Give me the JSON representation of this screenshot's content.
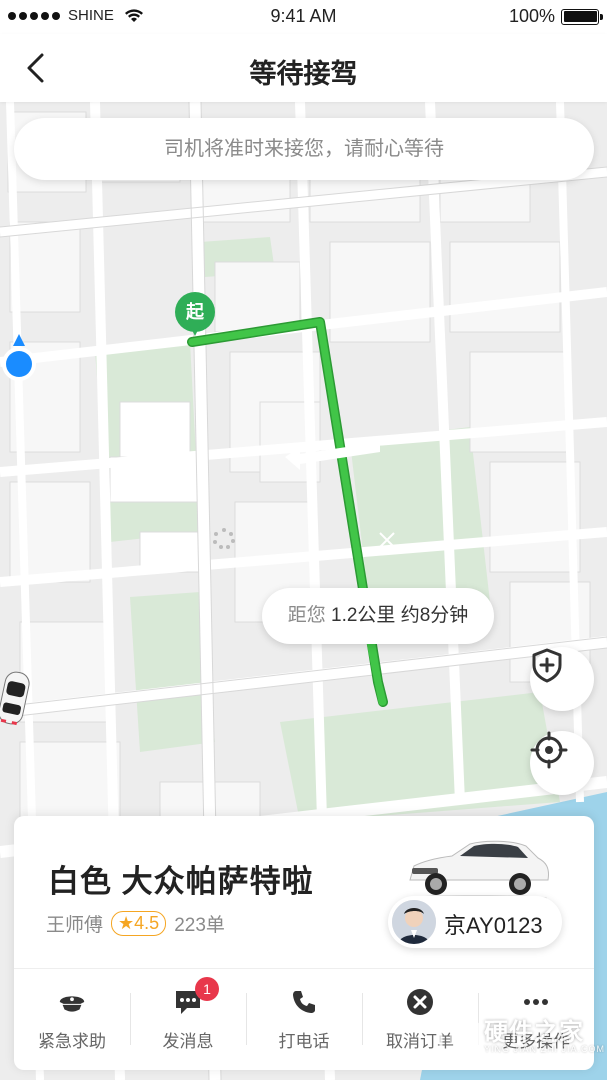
{
  "status_bar": {
    "carrier": "SHINE",
    "time": "9:41 AM",
    "battery": "100%"
  },
  "nav": {
    "title": "等待接驾",
    "back_icon": "chevron-left-icon"
  },
  "map": {
    "notice": "司机将准时来接您，请耐心等待",
    "start_label": "起",
    "eta_prefix": "距您",
    "eta_text": "1.2公里 约8分钟",
    "route_color": "#41c548",
    "start_color": "#2fae57",
    "my_location_color": "#1a8cff"
  },
  "ride": {
    "car_name": "白色 大众帕萨特啦",
    "driver": "王师傅",
    "rating": "★4.5",
    "orders": "223单",
    "plate": "京AY0123"
  },
  "actions": [
    {
      "label": "紧急求助",
      "icon": "police-icon"
    },
    {
      "label": "发消息",
      "icon": "message-icon",
      "badge": "1"
    },
    {
      "label": "打电话",
      "icon": "phone-icon"
    },
    {
      "label": "取消订单",
      "icon": "cancel-icon"
    },
    {
      "label": "更多操作",
      "icon": "more-icon"
    }
  ],
  "watermark": {
    "text": "硬件之家",
    "sub": "YING JIAN ZHI JIA.COM"
  }
}
